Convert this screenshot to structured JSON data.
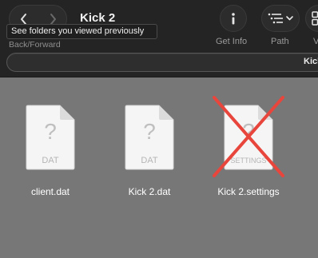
{
  "window": {
    "title": "Kick 2"
  },
  "toolbar": {
    "nav_caption": "Back/Forward",
    "tooltip": "See folders you viewed previously",
    "get_info_label": "Get Info",
    "path_label": "Path",
    "view_label": "V"
  },
  "pathbar": {
    "text": "Kick"
  },
  "files": [
    {
      "name": "client.dat",
      "type_label": "DAT",
      "icon": "unknown-document-icon",
      "excluded": false
    },
    {
      "name": "Kick 2.dat",
      "type_label": "DAT",
      "icon": "unknown-document-icon",
      "excluded": false
    },
    {
      "name": "Kick 2.settings",
      "type_label": "SETTINGS",
      "icon": "unknown-document-icon",
      "excluded": true
    }
  ],
  "colors": {
    "toolbar_bg": "#242424",
    "content_bg": "#777777",
    "cross_mark": "#e8463c"
  }
}
